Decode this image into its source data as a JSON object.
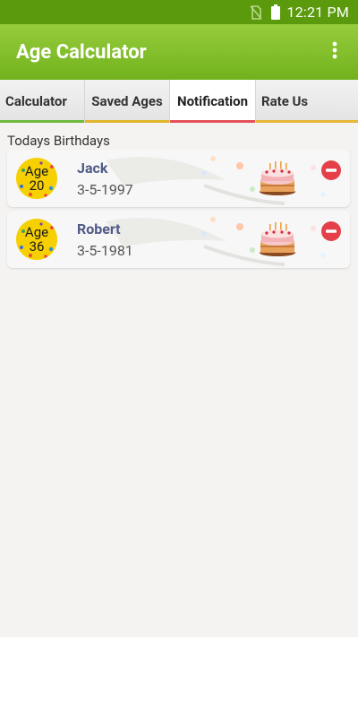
{
  "status_bar": {
    "time": "12:21 PM",
    "icons": [
      "no-sim-icon",
      "battery-icon"
    ]
  },
  "app_bar": {
    "title": "Age Calculator",
    "menu_icon": "more-vertical-icon"
  },
  "tabs": [
    {
      "label": "Calculator",
      "indicator_color": "#6dbb3c",
      "active": false
    },
    {
      "label": "Saved Ages",
      "indicator_color": "#e0b52a",
      "active": false
    },
    {
      "label": "Notification",
      "indicator_color": "#e5505a",
      "active": true
    },
    {
      "label": "Rate Us",
      "indicator_color": "#e7b636",
      "active": false
    }
  ],
  "section": {
    "title": "Todays Birthdays"
  },
  "birthdays": [
    {
      "age_word": "Age",
      "age": "20",
      "name": "Jack",
      "dob": "3-5-1997",
      "cake_icon": "birthday-cake-icon",
      "remove_icon": "remove-icon"
    },
    {
      "age_word": "Age",
      "age": "36",
      "name": "Robert",
      "dob": "3-5-1981",
      "cake_icon": "birthday-cake-icon",
      "remove_icon": "remove-icon"
    }
  ],
  "colors": {
    "status_bar": "#5a9a0c",
    "app_bar_top": "#97cc3d",
    "app_bar_bottom": "#71b21c",
    "content_bg": "#f5f3f1",
    "name_text": "#4f5a86",
    "badge": "#f6d000",
    "remove": "#e5404a"
  }
}
